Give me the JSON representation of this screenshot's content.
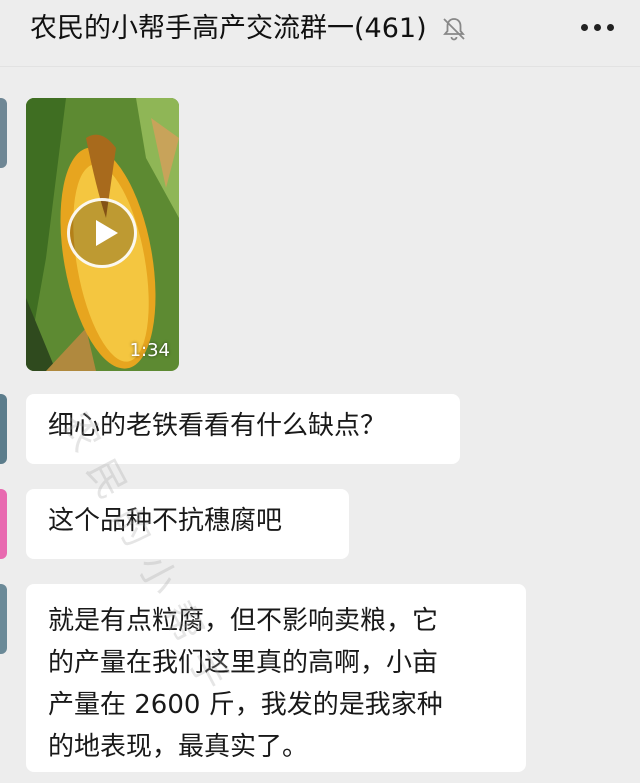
{
  "header": {
    "group_name": "农民的小帮手高产交流群一",
    "member_count": "(461)",
    "mute_icon": "bell-muted-icon",
    "more_icon": "more-dots-icon"
  },
  "messages": [
    {
      "type": "video",
      "duration": "1:34",
      "icon": "play-icon"
    },
    {
      "type": "text",
      "text": "细心的老铁看看有什么缺点？"
    },
    {
      "type": "text",
      "text": "这个品种不抗穗腐吧"
    },
    {
      "type": "text",
      "lines": [
        "就是有点粒腐，但不影响卖粮，它",
        "的产量在我们这里真的高啊，小亩",
        "产量在 2600 斤，我发的是我家种",
        "的地表现，最真实了。"
      ]
    }
  ],
  "watermark": "农民的小帮手",
  "colors": {
    "background": "#ededed",
    "bubble": "#ffffff",
    "text": "#191919"
  }
}
